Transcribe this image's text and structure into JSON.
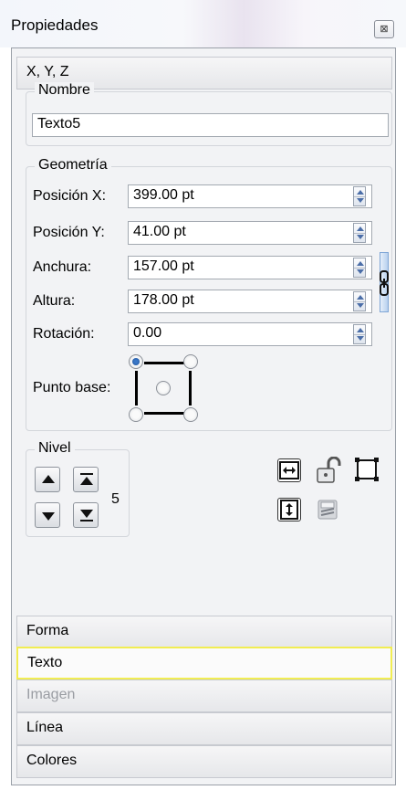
{
  "window": {
    "title": "Propiedades",
    "close_glyph": "⊠"
  },
  "sections": {
    "xyz": "X, Y, Z",
    "forma": "Forma",
    "texto": "Texto",
    "imagen": "Imagen",
    "linea": "Línea",
    "colores": "Colores"
  },
  "nombre": {
    "legend": "Nombre",
    "value": "Texto5"
  },
  "geometria": {
    "legend": "Geometría",
    "pos_x": {
      "label": "Posición X:",
      "value": "399.00 pt"
    },
    "pos_y": {
      "label": "Posición Y:",
      "value": "41.00 pt"
    },
    "anchura": {
      "label": "Anchura:",
      "value": "157.00 pt"
    },
    "altura": {
      "label": "Altura:",
      "value": "178.00 pt"
    },
    "rotacion": {
      "label": "Rotación:",
      "value": "0.00"
    },
    "punto_base": {
      "label": "Punto base:",
      "selected": "top-left"
    }
  },
  "nivel": {
    "legend": "Nivel",
    "value": "5"
  },
  "colors": {
    "selected_outline": "#f1ed52",
    "link_accent": "#7fa6d6"
  }
}
